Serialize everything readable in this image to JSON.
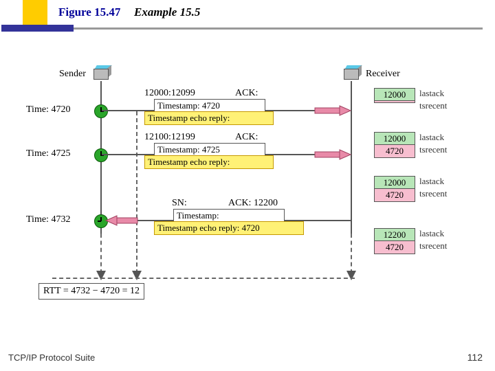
{
  "header": {
    "fig_num": "Figure 15.47",
    "title": "Example 15.5"
  },
  "footer": {
    "left": "TCP/IP Protocol Suite",
    "page": "112"
  },
  "roles": {
    "sender": "Sender",
    "receiver": "Receiver"
  },
  "times": {
    "t1": "Time: 4720",
    "t2": "Time: 4725",
    "t3": "Time: 4732"
  },
  "pkt1": {
    "seq": "12000:12099",
    "ack": "ACK:",
    "ts": "Timestamp: 4720",
    "echo": "Timestamp echo reply:"
  },
  "pkt2": {
    "seq": "12100:12199",
    "ack": "ACK:",
    "ts": "Timestamp: 4725",
    "echo": "Timestamp echo reply:"
  },
  "pkt3": {
    "sn": "SN:",
    "ack": "ACK: 12200",
    "ts": "Timestamp:",
    "echo": "Timestamp echo reply: 4720"
  },
  "rside": {
    "s1a": "12000",
    "s1b": " ",
    "s2a": "12000",
    "s2b": "4720",
    "s3a": "12000",
    "s3b": "4720",
    "s4a": "12200",
    "s4b": "4720",
    "lab_a": "lastack",
    "lab_b": "tsrecent"
  },
  "rtt": "RTT = 4732 − 4720 = 12"
}
